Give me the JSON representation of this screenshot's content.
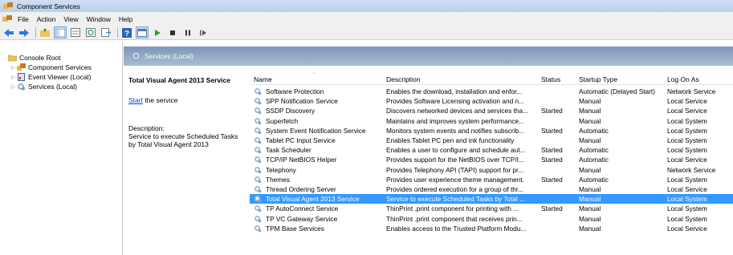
{
  "window": {
    "title": "Component Services"
  },
  "menu": [
    "File",
    "Action",
    "View",
    "Window",
    "Help"
  ],
  "toolbar": [
    "back-icon",
    "forward-icon",
    "up-folder-icon",
    "show-tree-icon",
    "properties-icon",
    "refresh-icon",
    "export-icon",
    "help-icon",
    "console-icon",
    "play-icon",
    "stop-icon",
    "pause-icon",
    "restart-icon"
  ],
  "tree": [
    {
      "label": "Console Root",
      "level": 0,
      "icon": "folder-icon",
      "expander": ""
    },
    {
      "label": "Component Services",
      "level": 1,
      "icon": "component-services-icon",
      "expander": "▷"
    },
    {
      "label": "Event Viewer (Local)",
      "level": 1,
      "icon": "event-viewer-icon",
      "expander": "▷"
    },
    {
      "label": "Services (Local)",
      "level": 1,
      "icon": "services-icon",
      "expander": "▷"
    }
  ],
  "header": {
    "title": "Services (Local)"
  },
  "extended": {
    "service_name": "Total Visual Agent 2013 Service",
    "start_link": "Start",
    "start_rest": " the service",
    "desc_label": "Description:",
    "desc_text": "Service to execute Scheduled Tasks by Total Visual Agent 2013"
  },
  "columns": [
    "Name",
    "Description",
    "Status",
    "Startup Type",
    "Log On As"
  ],
  "rows": [
    [
      "Software Protection",
      "Enables the download, installation and enfor...",
      "",
      "Automatic (Delayed Start)",
      "Network Service"
    ],
    [
      "SPP Notification Service",
      "Provides Software Licensing activation and n...",
      "",
      "Manual",
      "Local Service"
    ],
    [
      "SSDP Discovery",
      "Discovers networked devices and services tha...",
      "Started",
      "Manual",
      "Local Service"
    ],
    [
      "Superfetch",
      "Maintains and improves system performance...",
      "",
      "Manual",
      "Local System"
    ],
    [
      "System Event Notification Service",
      "Monitors system events and notifies subscrib...",
      "Started",
      "Automatic",
      "Local System"
    ],
    [
      "Tablet PC Input Service",
      "Enables Tablet PC pen and ink functionality",
      "",
      "Manual",
      "Local System"
    ],
    [
      "Task Scheduler",
      "Enables a user to configure and schedule aut...",
      "Started",
      "Automatic",
      "Local System"
    ],
    [
      "TCP/IP NetBIOS Helper",
      "Provides support for the NetBIOS over TCP/I...",
      "Started",
      "Automatic",
      "Local Service"
    ],
    [
      "Telephony",
      "Provides Telephony API (TAPI) support for pr...",
      "",
      "Manual",
      "Network Service"
    ],
    [
      "Themes",
      "Provides user experience theme management.",
      "Started",
      "Automatic",
      "Local System"
    ],
    [
      "Thread Ordering Server",
      "Provides ordered execution for a group of thr...",
      "",
      "Manual",
      "Local Service"
    ],
    [
      "Total Visual Agent 2013 Service",
      "Service to execute Scheduled Tasks by Total ...",
      "",
      "Manual",
      "Local System"
    ],
    [
      "TP AutoConnect Service",
      "ThinPrint .print component for printing with ...",
      "Started",
      "Manual",
      "Local System"
    ],
    [
      "TP VC Gateway Service",
      "ThinPrint .print component that receives prin...",
      "",
      "Manual",
      "Local System"
    ],
    [
      "TPM Base Services",
      "Enables access to the Trusted Platform Modu...",
      "",
      "Manual",
      "Local Service"
    ]
  ],
  "selected_row": 11
}
